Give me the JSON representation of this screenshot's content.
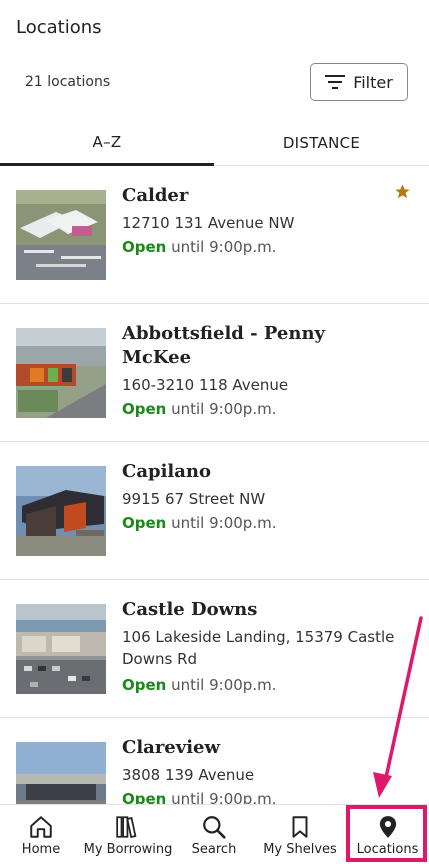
{
  "header": {
    "title": "Locations"
  },
  "toolbar": {
    "count_label": "21 locations",
    "filter_label": "Filter"
  },
  "tabs": [
    {
      "label": "A–Z",
      "active": true
    },
    {
      "label": "DISTANCE",
      "active": false
    }
  ],
  "locations": [
    {
      "name": "Calder",
      "address": "12710 131 Avenue NW",
      "status": "Open",
      "hours": " until 9:00p.m.",
      "favorite": true
    },
    {
      "name": "Abbottsfield - Penny McKee",
      "address": "160-3210 118 Avenue",
      "status": "Open",
      "hours": " until 9:00p.m.",
      "favorite": false
    },
    {
      "name": "Capilano",
      "address": "9915 67 Street NW",
      "status": "Open",
      "hours": " until 9:00p.m.",
      "favorite": false
    },
    {
      "name": "Castle Downs",
      "address": "106 Lakeside Landing, 15379 Castle Downs Rd",
      "status": "Open",
      "hours": " until 9:00p.m.",
      "favorite": false
    },
    {
      "name": "Clareview",
      "address": "3808 139 Avenue",
      "status": "Open",
      "hours": " until 9:00p.m.",
      "favorite": false
    }
  ],
  "nav": [
    {
      "label": "Home",
      "icon": "home-icon"
    },
    {
      "label": "My Borrowing",
      "icon": "books-icon"
    },
    {
      "label": "Search",
      "icon": "search-icon"
    },
    {
      "label": "My Shelves",
      "icon": "bookmark-icon"
    },
    {
      "label": "Locations",
      "icon": "location-pin-icon",
      "active": true
    }
  ],
  "colors": {
    "open": "#1a8a1a",
    "favorite_star": "#b87a0a",
    "highlight": "#e0186c"
  }
}
